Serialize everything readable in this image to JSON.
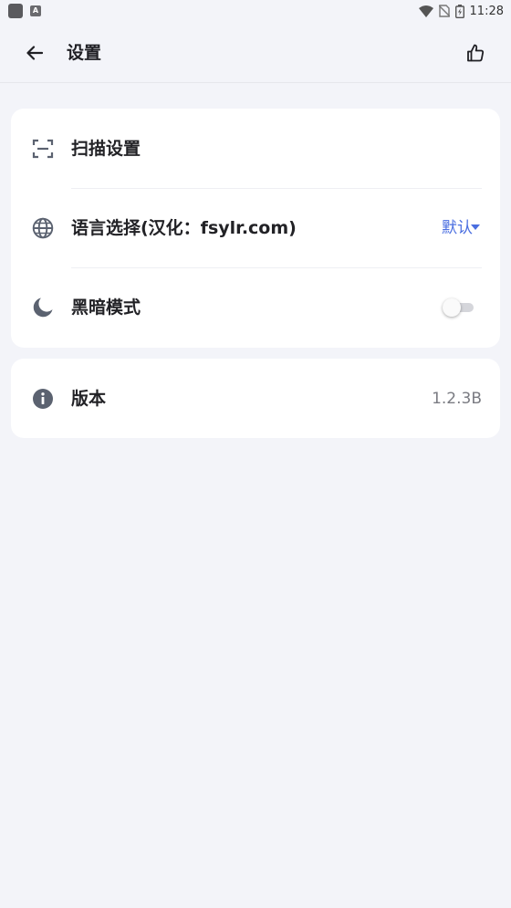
{
  "status_bar": {
    "time": "11:28",
    "icons": [
      "app-notification-icon",
      "a-notification-icon",
      "wifi-icon",
      "no-sim-icon",
      "battery-icon"
    ]
  },
  "app_bar": {
    "title": "设置",
    "back_icon": "arrow-left-icon",
    "action_icon": "thumbs-up-icon"
  },
  "settings": {
    "scan": {
      "label": "扫描设置",
      "icon": "scan-frame-icon"
    },
    "language": {
      "label": "语言选择(汉化：fsylr.com)",
      "value": "默认",
      "icon": "globe-icon"
    },
    "dark_mode": {
      "label": "黑暗模式",
      "enabled": false,
      "icon": "moon-icon"
    },
    "version": {
      "label": "版本",
      "value": "1.2.3B",
      "icon": "info-icon"
    }
  },
  "colors": {
    "background": "#f3f4f9",
    "card": "#ffffff",
    "accent": "#4a6ee0",
    "icon": "#5b6270"
  }
}
